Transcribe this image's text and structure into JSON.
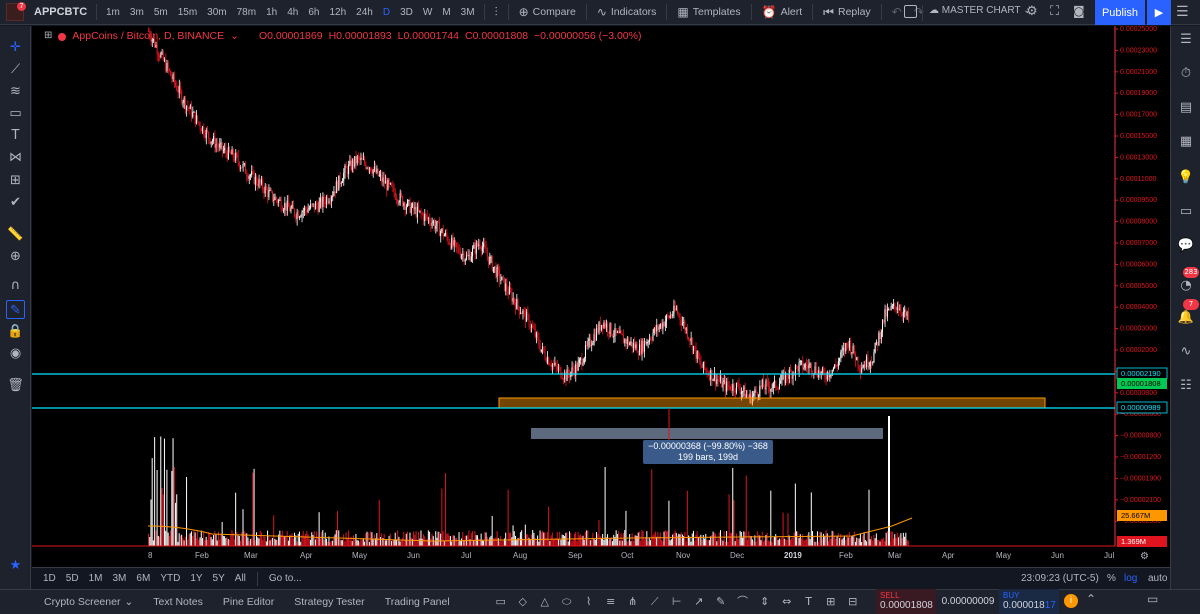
{
  "header": {
    "symbol": "APPCBTC",
    "notification_count": "7",
    "timeframes": [
      "1m",
      "3m",
      "5m",
      "15m",
      "30m",
      "78m",
      "1h",
      "4h",
      "6h",
      "12h",
      "24h",
      "D",
      "3D",
      "W",
      "M",
      "3M"
    ],
    "active_timeframe": "D",
    "compare_label": "Compare",
    "indicators_label": "Indicators",
    "templates_label": "Templates",
    "alert_label": "Alert",
    "replay_label": "Replay",
    "layout_name": "MASTER CHART",
    "publish_label": "Publish"
  },
  "legend": {
    "title": "AppCoins / Bitcoin, D, BINANCE",
    "open": "O0.00001869",
    "high": "H0.00001893",
    "low": "L0.00001744",
    "close": "C0.00001808",
    "change": "−0.00000056 (−3.00%)"
  },
  "price_scale": {
    "labels": [
      "0.00025000",
      "0.00023000",
      "0.00021000",
      "0.00019000",
      "0.00017000",
      "0.00015000",
      "0.00013000",
      "0.00011000",
      "0.00009500",
      "0.00008000",
      "0.00007000",
      "0.00006000",
      "0.00005000",
      "0.00004000",
      "0.00003000",
      "0.00002000",
      "0.00001000",
      "0.00000800",
      "−0.00000600",
      "−0.00000800",
      "−0.00001200",
      "−0.00001900",
      "−0.00002100",
      "−0.00002300"
    ],
    "line_upper": "0.00002190",
    "last_price": "0.00001808",
    "line_lower": "0.00000989",
    "volume_ma": "25.667M",
    "volume_last": "1.369M"
  },
  "time_axis": {
    "labels": [
      "8",
      "Feb",
      "Mar",
      "Apr",
      "May",
      "Jun",
      "Jul",
      "Aug",
      "Sep",
      "Oct",
      "Nov",
      "Dec",
      "2019",
      "Feb",
      "Mar",
      "Apr",
      "May",
      "Jun",
      "Jul"
    ],
    "bold_label": "2019"
  },
  "measure": {
    "line1": "−0.00000368 (−99.80%) −368",
    "line2": "199 bars, 199d"
  },
  "range_bar": {
    "ranges": [
      "1D",
      "5D",
      "1M",
      "3M",
      "6M",
      "YTD",
      "1Y",
      "5Y",
      "All"
    ],
    "goto": "Go to...",
    "clock": "23:09:23 (UTC-5)",
    "percent": "%",
    "log": "log",
    "auto": "auto"
  },
  "bottom_tabs": [
    "Crypto Screener",
    "Text Notes",
    "Pine Editor",
    "Strategy Tester",
    "Trading Panel"
  ],
  "trade": {
    "sell_label": "SELL",
    "sell_price": "0.00001808",
    "spread": "0.00000009",
    "buy_label": "BUY",
    "buy_price_main": "0.000018",
    "buy_price_tail": "17"
  },
  "right_badges": {
    "chat": "283",
    "alerts": "7"
  },
  "chart_data": {
    "type": "candlestick",
    "title": "AppCoins / Bitcoin, D, BINANCE",
    "x_ticks": [
      "8",
      "Feb",
      "Mar",
      "Apr",
      "May",
      "Jun",
      "Jul",
      "Aug",
      "Sep",
      "Oct",
      "Nov",
      "Dec",
      "2019",
      "Feb",
      "Mar",
      "Apr",
      "May",
      "Jun",
      "Jul"
    ],
    "series": [
      {
        "name": "AppCoins / Bitcoin",
        "approx_close": [
          0.00025,
          0.0002,
          0.00016,
          0.00013,
          0.00011,
          9.5e-05,
          8.5e-05,
          8e-05,
          7e-05,
          6.3e-05,
          5.6e-05,
          5.2e-05,
          4.8e-05,
          5e-05,
          5.2e-05,
          5.8e-05,
          7e-05,
          7.8e-05,
          7.4e-05,
          6.5e-05,
          5.8e-05,
          5.2e-05,
          4.8e-05,
          4.5e-05,
          4e-05,
          3.5e-05,
          3.2e-05,
          3.7e-05,
          3e-05,
          2.5e-05,
          2.1e-05,
          1.8e-05,
          1.4e-05,
          1.2e-05,
          1.1e-05,
          1.2e-05,
          1.5e-05,
          1.8e-05,
          1.6e-05,
          1.5e-05,
          1.4e-05,
          1.6e-05,
          1.8e-05,
          2e-05,
          1.6e-05,
          1.2e-05,
          1.1e-05,
          1e-05,
          1e-05,
          9e-06,
          1e-05,
          1e-05,
          1.1e-05,
          1.2e-05,
          1.2e-05,
          1.1e-05,
          1.2e-05,
          1.5e-05,
          1.2e-05,
          1.3e-05,
          1.9e-05,
          2.1e-05,
          1.8e-05
        ]
      }
    ],
    "horizontal_lines": [
      2.19e-05,
      9.89e-06
    ],
    "last_price": 1.808e-05,
    "log_scale": true
  }
}
